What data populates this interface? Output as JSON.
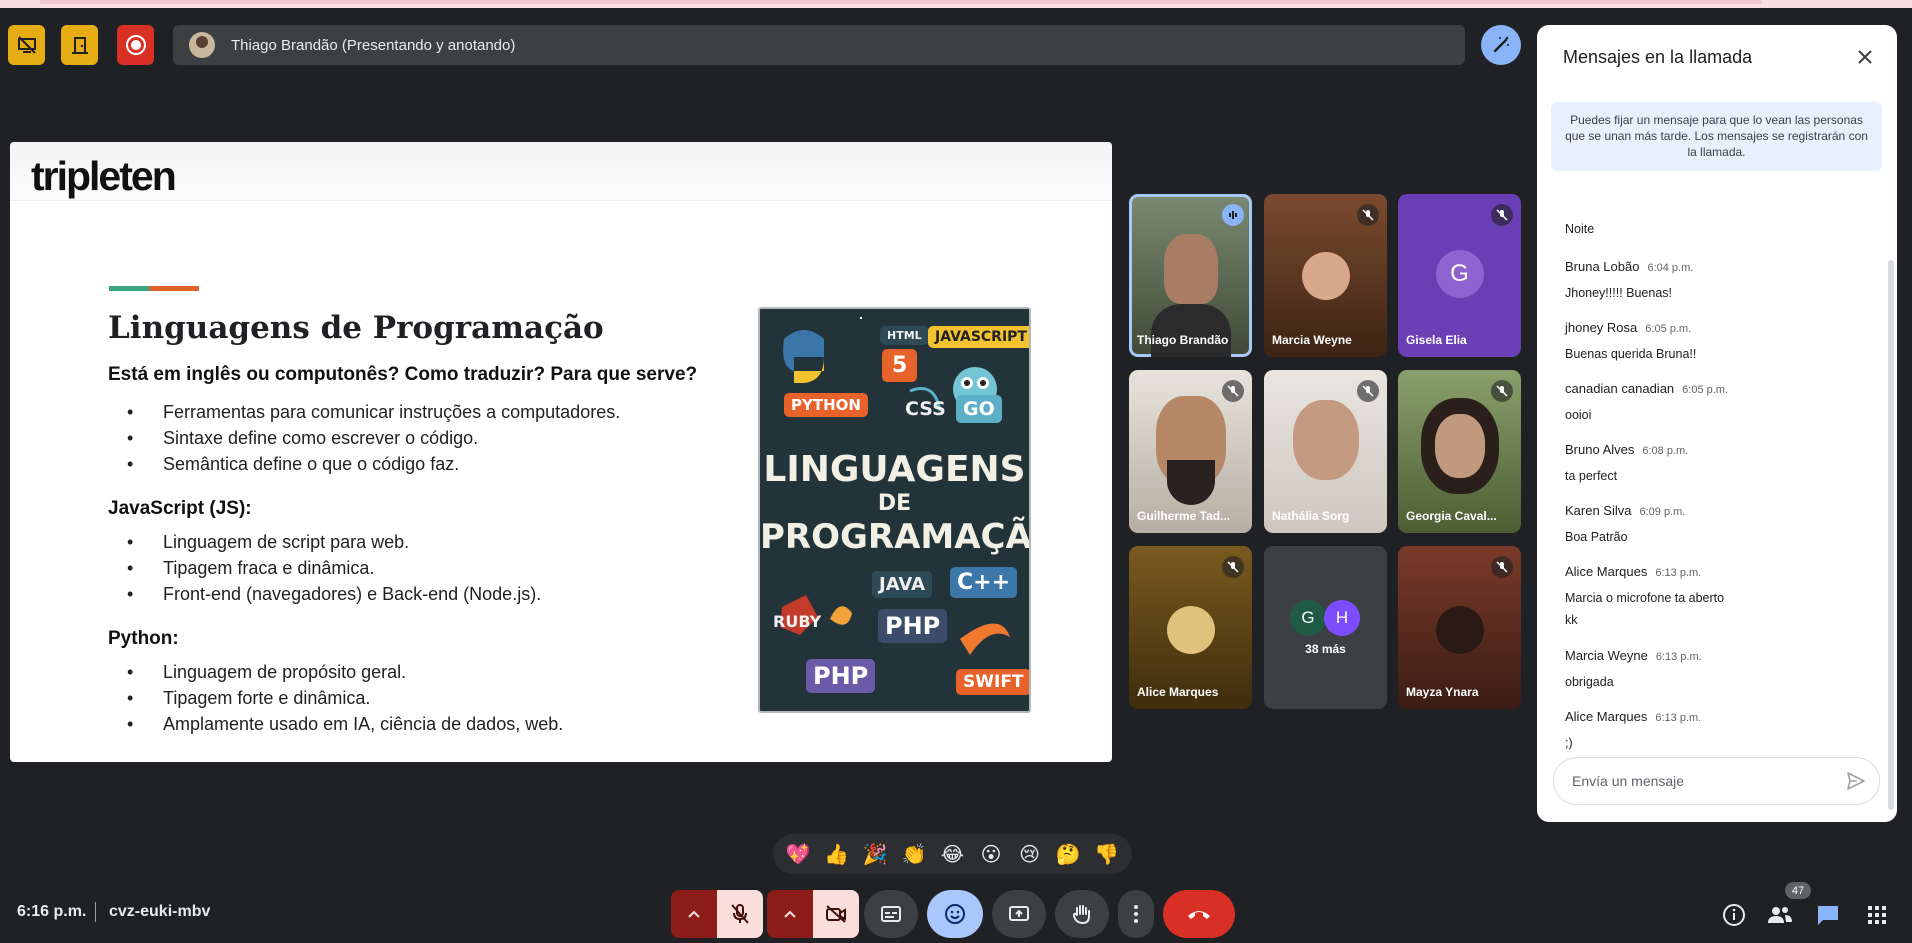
{
  "top": {
    "presenter_label": "Thiago Brandão (Presentando y anotando)"
  },
  "slide": {
    "logo": "tripleten",
    "title": "Linguagens de Programação",
    "subtitle": "Está em inglês ou computonês? Como traduzir? Para que serve?",
    "bullets_intro": [
      "Ferramentas para comunicar instruções a computadores.",
      "Sintaxe define como escrever o código.",
      "Semântica define o que o código faz."
    ],
    "js_heading": "JavaScript (JS):",
    "bullets_js": [
      "Linguagem de script para web.",
      "Tipagem fraca e dinâmica.",
      "Front-end (navegadores) e Back-end (Node.js)."
    ],
    "py_heading": "Python:",
    "bullets_py": [
      "Linguagem de propósito geral.",
      "Tipagem forte e dinâmica.",
      "Amplamente usado em IA, ciência de dados, web."
    ],
    "poster": {
      "line1": "LINGUAGENS",
      "line2": "DE",
      "line3": "PROGRAMAÇÃO",
      "tags": [
        "HTML",
        "5",
        "JAVASCRIPT",
        "PYTHON",
        "CSS",
        "GO",
        "JAVA",
        "C++",
        "RUBY",
        "PHP",
        "PHP",
        "SWIFT"
      ]
    }
  },
  "participants": [
    {
      "name": "Thiago Brandão",
      "muted": false,
      "speaking": true
    },
    {
      "name": "Marcia Weyne",
      "muted": true
    },
    {
      "name": "Gisela Elia",
      "muted": true,
      "initial": "G"
    },
    {
      "name": "Guilherme Tad...",
      "muted": true
    },
    {
      "name": "Nathália Sorg",
      "muted": true
    },
    {
      "name": "Georgia Caval...",
      "muted": true
    },
    {
      "name": "Alice Marques",
      "muted": true
    },
    {
      "name": "38 más",
      "initials": [
        "G",
        "H"
      ]
    },
    {
      "name": "Mayza Ynara",
      "muted": true
    }
  ],
  "chat": {
    "title": "Mensajes en la llamada",
    "pin_note": "Puedes fijar un mensaje para que lo vean las personas que se unan más tarde. Los mensajes se registrarán con la llamada.",
    "messages": [
      {
        "who": "",
        "time": "",
        "text": "Noite"
      },
      {
        "who": "Bruna Lobão",
        "time": "6:04 p.m.",
        "text": "Jhoney!!!!! Buenas!"
      },
      {
        "who": "jhoney Rosa",
        "time": "6:05 p.m.",
        "text": "Buenas querida Bruna!!"
      },
      {
        "who": "canadian canadian",
        "time": "6:05 p.m.",
        "text": "ooioi"
      },
      {
        "who": "Bruno Alves",
        "time": "6:08 p.m.",
        "text": "ta perfect"
      },
      {
        "who": "Karen Silva",
        "time": "6:09 p.m.",
        "text": "Boa Patrão"
      },
      {
        "who": "Alice Marques",
        "time": "6:13 p.m.",
        "text": "Marcia o microfone ta aberto",
        "text2": "kk"
      },
      {
        "who": "Marcia Weyne",
        "time": "6:13 p.m.",
        "text": "obrigada"
      },
      {
        "who": "Alice Marques",
        "time": "6:13 p.m.",
        "text": ";)"
      }
    ],
    "input_placeholder": "Envía un mensaje"
  },
  "reactions": [
    "💖",
    "👍",
    "🎉",
    "👏",
    "😂",
    "😮",
    "😢",
    "🤔",
    "👎"
  ],
  "bottom": {
    "time": "6:16 p.m.",
    "meeting_code": "cvz-euki-mbv",
    "participant_count": "47"
  },
  "colors": {
    "background": "#202124",
    "accent_blue": "#8ab4f8",
    "end_call": "#d93025",
    "warning_yellow": "#e5ad13"
  }
}
